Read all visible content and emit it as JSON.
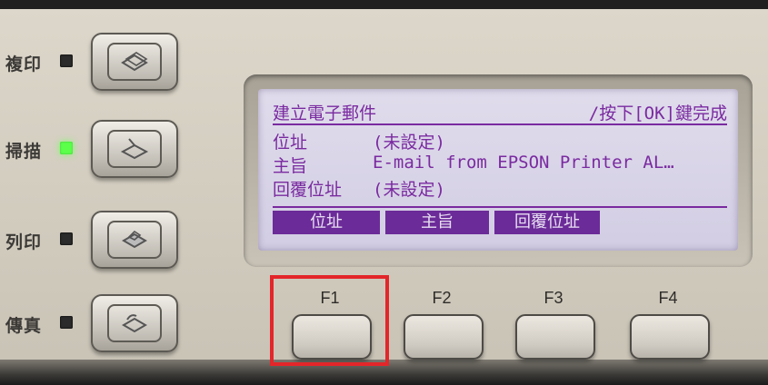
{
  "mode_buttons": [
    {
      "label": "複印",
      "led": "off",
      "icon": "copy-icon"
    },
    {
      "label": "掃描",
      "led": "on",
      "icon": "scan-icon"
    },
    {
      "label": "列印",
      "led": "off",
      "icon": "print-icon"
    },
    {
      "label": "傳真",
      "led": "off",
      "icon": "fax-icon"
    }
  ],
  "lcd": {
    "title": "建立電子郵件",
    "hint": "/按下[OK]鍵完成",
    "rows": [
      {
        "label": "位址",
        "value": "(未設定)"
      },
      {
        "label": "主旨",
        "value": "E-mail from EPSON Printer AL…"
      },
      {
        "label": "回覆位址",
        "value": "(未設定)"
      }
    ],
    "tabs": [
      "位址",
      "主旨",
      "回覆位址"
    ]
  },
  "function_keys": [
    "F1",
    "F2",
    "F3",
    "F4"
  ],
  "colors": {
    "lcd_text": "#7a2aa0",
    "led_on": "#5cff4a",
    "highlight": "#e3262a"
  }
}
